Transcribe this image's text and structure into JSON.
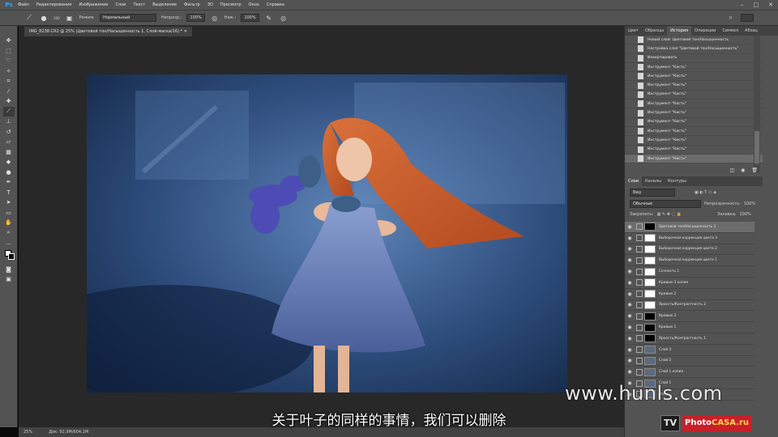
{
  "menubar": {
    "logo": "Ps",
    "items": [
      "Файл",
      "Редактирование",
      "Изображение",
      "Слои",
      "Текст",
      "Выделение",
      "Фильтр",
      "3D",
      "Просмотр",
      "Окно",
      "Справка"
    ]
  },
  "options": {
    "brush_size": "100",
    "mode_label": "Режим:",
    "mode_value": "Нормальный",
    "opacity_label": "Непрозр.:",
    "opacity_value": "100%",
    "flow_label": "Наж.:",
    "flow_value": "100%"
  },
  "document": {
    "tab_title": "IMG_8238.CR2 @ 25% (Цветовой тон/Насыщенность 1, Слой-маска/16) *"
  },
  "status": {
    "zoom": "25%",
    "doc_size": "Док: 92,9M/604,1M"
  },
  "panel_tabs": [
    "Цвет",
    "Образцы",
    "История",
    "Операции",
    "Символ",
    "Абзац"
  ],
  "history": [
    {
      "label": "Новый слой: Цветовой тон/Насыщенность"
    },
    {
      "label": "Настройка слоя \"Цветовой тон/Насыщенность\""
    },
    {
      "label": "Инвертировать"
    },
    {
      "label": "Инструмент \"Кисть\""
    },
    {
      "label": "Инструмент \"Кисть\""
    },
    {
      "label": "Инструмент \"Кисть\""
    },
    {
      "label": "Инструмент \"Кисть\""
    },
    {
      "label": "Инструмент \"Кисть\""
    },
    {
      "label": "Инструмент \"Кисть\""
    },
    {
      "label": "Инструмент \"Кисть\""
    },
    {
      "label": "Инструмент \"Кисть\""
    },
    {
      "label": "Инструмент \"Кисть\""
    },
    {
      "label": "Инструмент \"Кисть\""
    },
    {
      "label": "Инструмент \"Кисть\""
    }
  ],
  "layers_tabs": [
    "Слои",
    "Каналы",
    "Контуры"
  ],
  "layers_controls": {
    "kind": "Вид",
    "blend": "Обычные",
    "opacity_label": "Непрозрачность:",
    "opacity_value": "100%",
    "lock_label": "Закрепить:",
    "fill_label": "Заливка:",
    "fill_value": "100%"
  },
  "layers": [
    {
      "name": "Цветовой тон/Насыщенность 1",
      "mask": "dark"
    },
    {
      "name": "Выборочная коррекция цвета 3",
      "mask": "light"
    },
    {
      "name": "Выборочная коррекция цвета 2",
      "mask": "light"
    },
    {
      "name": "Выборочная коррекция цвета 1",
      "mask": "light"
    },
    {
      "name": "Сочность 1",
      "mask": "light"
    },
    {
      "name": "Кривые 3 копия",
      "mask": "light"
    },
    {
      "name": "Кривые 2",
      "mask": "light"
    },
    {
      "name": "Яркость/Контрастность 2",
      "mask": "light"
    },
    {
      "name": "Кривые 2",
      "mask": "dark"
    },
    {
      "name": "Кривые 1",
      "mask": "dark"
    },
    {
      "name": "Яркость/Контрастность 1",
      "mask": "dark"
    },
    {
      "name": "Слой 3",
      "mask": "photo"
    },
    {
      "name": "Слой 2",
      "mask": "photo"
    },
    {
      "name": "Слой 1 копия",
      "mask": "photo"
    },
    {
      "name": "Слой 1",
      "mask": "photo"
    },
    {
      "name": "Фон",
      "mask": "photo"
    }
  ],
  "overlay": {
    "subtitle": "关于叶子的同样的事情，我们可以删除",
    "watermark": "www.hunls.com",
    "logo_tv": "TV",
    "logo_photo": "Photo",
    "logo_casa": "CASA.ru"
  }
}
